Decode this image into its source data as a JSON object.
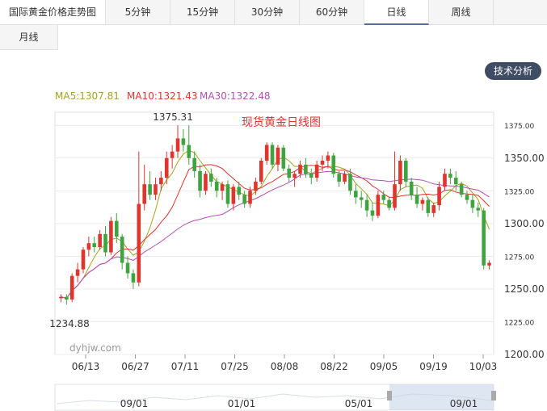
{
  "tabs": {
    "title": "国际黄金价格走势图",
    "items": [
      "5分钟",
      "15分钟",
      "30分钟",
      "60分钟",
      "日线",
      "周线",
      "月线"
    ],
    "active": "日线"
  },
  "analysis_button": "技术分析",
  "ma_labels": [
    {
      "text": "MA5:1307.81",
      "color": "#a3a320"
    },
    {
      "text": "MA10:1321.43",
      "color": "#e0342f"
    },
    {
      "text": "MA30:1322.48",
      "color": "#b44fb4"
    }
  ],
  "watermark": "dyhjw.com",
  "navigator_labels": [
    "09/01",
    "01/01",
    "05/01",
    "09/01"
  ],
  "colors": {
    "up": "#e0342f",
    "down": "#3fa33f",
    "ma5": "#a3a320",
    "ma10": "#e0342f",
    "ma30": "#b44fb4"
  },
  "chart_data": {
    "type": "candlestick",
    "title": "现货黄金日线图",
    "y_ticks": [
      "1200.00",
      "1225.00",
      "1250.00",
      "1275.00",
      "1300.00",
      "1325.00",
      "1350.00",
      "1375.00"
    ],
    "x_ticks": [
      "06/13",
      "06/27",
      "07/11",
      "07/25",
      "08/08",
      "08/22",
      "09/05",
      "09/19",
      "10/03"
    ],
    "ylim": [
      1200,
      1385
    ],
    "annotations": [
      {
        "label": "1375.31"
      },
      {
        "label": "1234.88"
      }
    ],
    "series_ma": [
      "MA5",
      "MA10",
      "MA30"
    ],
    "candles": [
      [
        1243,
        1246,
        1240,
        1244
      ],
      [
        1244,
        1246,
        1238,
        1242
      ],
      [
        1242,
        1262,
        1240,
        1260
      ],
      [
        1260,
        1270,
        1255,
        1265
      ],
      [
        1265,
        1282,
        1262,
        1280
      ],
      [
        1280,
        1290,
        1275,
        1285
      ],
      [
        1285,
        1290,
        1278,
        1282
      ],
      [
        1282,
        1295,
        1280,
        1292
      ],
      [
        1292,
        1298,
        1275,
        1278
      ],
      [
        1278,
        1305,
        1276,
        1302
      ],
      [
        1302,
        1308,
        1285,
        1290
      ],
      [
        1290,
        1292,
        1265,
        1270
      ],
      [
        1270,
        1275,
        1258,
        1262
      ],
      [
        1262,
        1265,
        1250,
        1255
      ],
      [
        1255,
        1355,
        1252,
        1315
      ],
      [
        1315,
        1345,
        1310,
        1330
      ],
      [
        1330,
        1340,
        1318,
        1322
      ],
      [
        1322,
        1335,
        1318,
        1330
      ],
      [
        1330,
        1340,
        1325,
        1335
      ],
      [
        1335,
        1355,
        1330,
        1350
      ],
      [
        1350,
        1360,
        1342,
        1355
      ],
      [
        1355,
        1375,
        1350,
        1365
      ],
      [
        1365,
        1372,
        1355,
        1360
      ],
      [
        1360,
        1375,
        1345,
        1350
      ],
      [
        1350,
        1355,
        1335,
        1340
      ],
      [
        1340,
        1345,
        1320,
        1325
      ],
      [
        1325,
        1340,
        1322,
        1338
      ],
      [
        1338,
        1342,
        1328,
        1332
      ],
      [
        1332,
        1335,
        1320,
        1325
      ],
      [
        1325,
        1332,
        1318,
        1330
      ],
      [
        1330,
        1333,
        1312,
        1315
      ],
      [
        1315,
        1330,
        1310,
        1328
      ],
      [
        1328,
        1332,
        1318,
        1322
      ],
      [
        1322,
        1325,
        1312,
        1315
      ],
      [
        1315,
        1328,
        1312,
        1325
      ],
      [
        1325,
        1335,
        1322,
        1332
      ],
      [
        1332,
        1350,
        1330,
        1348
      ],
      [
        1348,
        1362,
        1345,
        1360
      ],
      [
        1360,
        1362,
        1342,
        1345
      ],
      [
        1345,
        1360,
        1340,
        1358
      ],
      [
        1358,
        1360,
        1340,
        1342
      ],
      [
        1342,
        1345,
        1332,
        1335
      ],
      [
        1335,
        1340,
        1328,
        1338
      ],
      [
        1338,
        1348,
        1335,
        1345
      ],
      [
        1345,
        1350,
        1335,
        1338
      ],
      [
        1338,
        1342,
        1330,
        1335
      ],
      [
        1335,
        1348,
        1332,
        1345
      ],
      [
        1345,
        1352,
        1340,
        1348
      ],
      [
        1348,
        1355,
        1342,
        1352
      ],
      [
        1352,
        1354,
        1335,
        1338
      ],
      [
        1338,
        1340,
        1328,
        1332
      ],
      [
        1332,
        1340,
        1330,
        1338
      ],
      [
        1338,
        1342,
        1322,
        1325
      ],
      [
        1325,
        1330,
        1315,
        1320
      ],
      [
        1320,
        1325,
        1312,
        1318
      ],
      [
        1318,
        1322,
        1305,
        1310
      ],
      [
        1310,
        1316,
        1302,
        1306
      ],
      [
        1306,
        1325,
        1304,
        1322
      ],
      [
        1322,
        1325,
        1315,
        1318
      ],
      [
        1318,
        1320,
        1310,
        1312
      ],
      [
        1312,
        1355,
        1310,
        1330
      ],
      [
        1330,
        1352,
        1325,
        1348
      ],
      [
        1348,
        1350,
        1328,
        1332
      ],
      [
        1332,
        1335,
        1318,
        1322
      ],
      [
        1322,
        1328,
        1312,
        1315
      ],
      [
        1315,
        1320,
        1310,
        1318
      ],
      [
        1318,
        1320,
        1305,
        1308
      ],
      [
        1308,
        1316,
        1305,
        1314
      ],
      [
        1314,
        1332,
        1310,
        1328
      ],
      [
        1328,
        1342,
        1325,
        1338
      ],
      [
        1338,
        1342,
        1330,
        1335
      ],
      [
        1335,
        1340,
        1325,
        1330
      ],
      [
        1330,
        1332,
        1320,
        1322
      ],
      [
        1322,
        1325,
        1315,
        1318
      ],
      [
        1318,
        1322,
        1308,
        1312
      ],
      [
        1312,
        1316,
        1305,
        1310
      ],
      [
        1310,
        1312,
        1265,
        1268
      ],
      [
        1268,
        1272,
        1265,
        1270
      ]
    ]
  }
}
